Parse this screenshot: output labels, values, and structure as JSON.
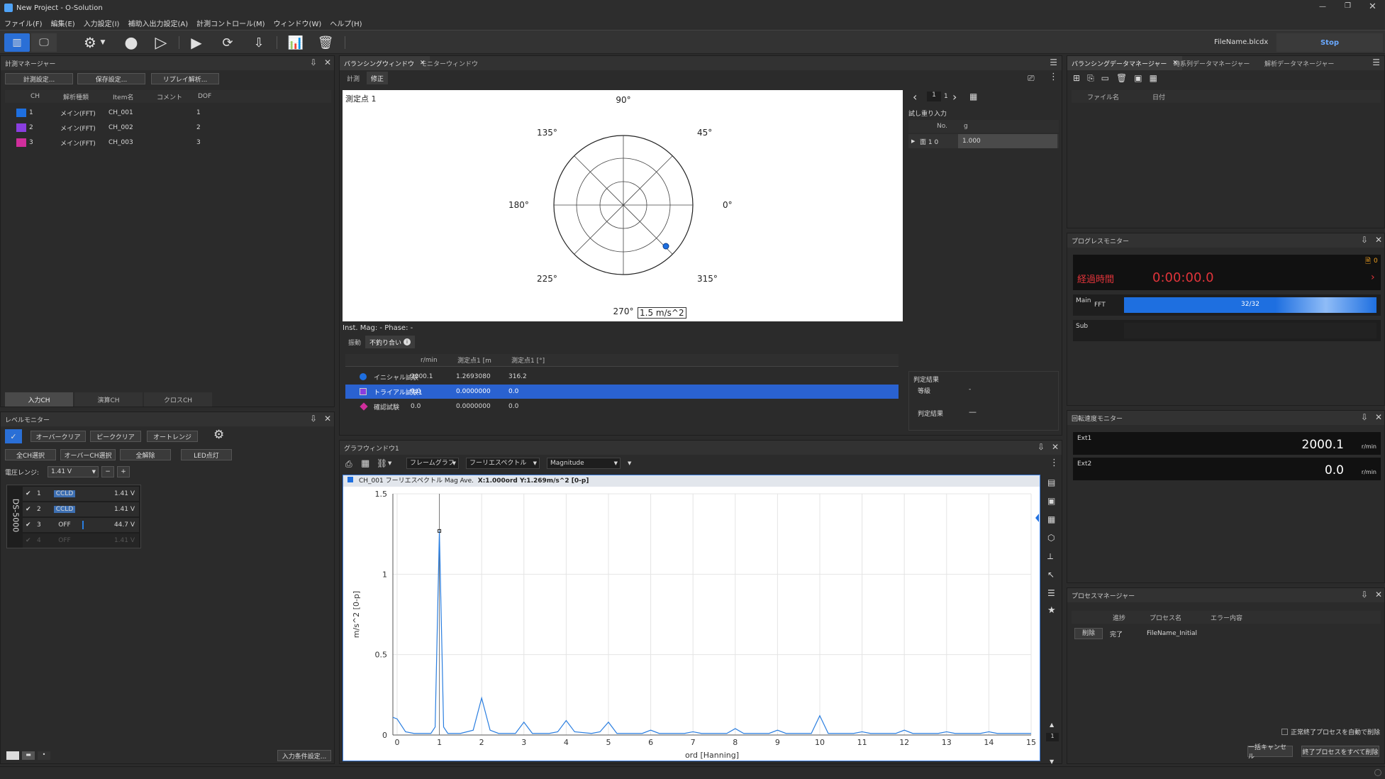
{
  "app": {
    "title": "New Project - O-Solution"
  },
  "menu": [
    "ファイル(F)",
    "編集(E)",
    "入力設定(I)",
    "補助入出力設定(A)",
    "計測コントロール(M)",
    "ウィンドウ(W)",
    "ヘルプ(H)"
  ],
  "toolbar": {
    "filename": "FileName.blcdx",
    "stop_label": "Stop"
  },
  "measure_manager": {
    "title": "計測マネージャー",
    "buttons": [
      "計測設定...",
      "保存設定...",
      "リプレイ解析..."
    ],
    "columns": [
      "CH",
      "解析種類",
      "Item名",
      "コメント",
      "DOF"
    ],
    "rows": [
      {
        "ch": "1",
        "type": "メイン(FFT)",
        "item": "CH_001",
        "comment": "",
        "dof": "1",
        "color": "#1e6fe0"
      },
      {
        "ch": "2",
        "type": "メイン(FFT)",
        "item": "CH_002",
        "comment": "",
        "dof": "2",
        "color": "#8a3ee0"
      },
      {
        "ch": "3",
        "type": "メイン(FFT)",
        "item": "CH_003",
        "comment": "",
        "dof": "3",
        "color": "#d02e9c"
      }
    ],
    "tabs": [
      "入力CH",
      "演算CH",
      "クロスCH"
    ]
  },
  "level_monitor": {
    "title": "レベルモニター",
    "buttons1": [
      "オーバークリア",
      "ピーククリア",
      "オートレンジ"
    ],
    "buttons2": [
      "全CH選択",
      "オーバーCH選択",
      "全解除",
      "LED点灯"
    ],
    "range_label": "電圧レンジ:",
    "range_value": "1.41 V",
    "device": "DS-5000",
    "channels": [
      {
        "num": "1",
        "mode": "CCLD",
        "value": "1.41 V"
      },
      {
        "num": "2",
        "mode": "CCLD",
        "value": "1.41 V"
      },
      {
        "num": "3",
        "mode": "OFF",
        "value": "44.7 V"
      },
      {
        "num": "4",
        "mode": "OFF",
        "value": "1.41 V"
      }
    ],
    "input_settings": "入力条件設定..."
  },
  "balancing": {
    "tabs": [
      "バランシングウィンドウ",
      "モニターウィンドウ"
    ],
    "subtabs": [
      "計測",
      "修正"
    ],
    "point_label": "測定点 1",
    "angles": {
      "a90": "90°",
      "a45": "45°",
      "a0": "0°",
      "a315": "315°",
      "a270": "270°",
      "a225": "225°",
      "a180": "180°",
      "a135": "135°"
    },
    "scale_label": "1.5 m/s^2",
    "inst_label": "Inst.  Mag: -   Phase: -",
    "result_tabs": [
      "振動",
      "不釣り合い"
    ],
    "table_cols": [
      "r/min",
      "測定点1 [m",
      "測定点1 [°]"
    ],
    "table_rows": [
      {
        "name": "イニシャル試験",
        "rpm": "2000.1",
        "mag": "1.2693080",
        "phase": "316.2",
        "color": "#1e6fe0"
      },
      {
        "name": "トライアル試験1",
        "rpm": "0.0",
        "mag": "0.0000000",
        "phase": "0.0",
        "color": "#8a3ee0"
      },
      {
        "name": "確認試験",
        "rpm": "0.0",
        "mag": "0.0000000",
        "phase": "0.0",
        "color": "#d02e9c"
      }
    ],
    "page_current": "1",
    "page_total": "1",
    "trial_title": "試し重り入力",
    "trial_cols": [
      "No.",
      "g"
    ],
    "trial_row": {
      "no": "面 1 0",
      "g": "1.000"
    },
    "judge_title": "判定結果",
    "grade_label": "等級",
    "grade_value": "-",
    "judge_label": "判定結果",
    "judge_value": "—"
  },
  "graph": {
    "title": "グラフウィンドウ1",
    "dropdowns": [
      "フレームグラフ",
      "フーリエスペクトル",
      "Magnitude"
    ],
    "legend": "CH_001   フーリエスペクトル  Mag  Ave.",
    "cursor": "X:1.000ord   Y:1.269m/s^2 [0-p]",
    "page_indicator": "1"
  },
  "chart_data": {
    "type": "line",
    "xlabel": "ord [Hanning]",
    "ylabel": "m/s^2 [0-p]",
    "xlim": [
      -0.1,
      15
    ],
    "ylim": [
      0,
      1.5
    ],
    "xticks": [
      "0",
      "1",
      "2",
      "3",
      "4",
      "5",
      "6",
      "7",
      "8",
      "9",
      "10",
      "11",
      "12",
      "13",
      "14",
      "15"
    ],
    "yticks": [
      "0",
      "0.5",
      "1",
      "1.5"
    ],
    "x": [
      -0.1,
      0,
      0.2,
      0.4,
      0.8,
      0.9,
      1,
      1.1,
      1.2,
      1.5,
      1.8,
      2,
      2.2,
      2.4,
      2.8,
      3,
      3.2,
      3.6,
      3.8,
      4,
      4.2,
      4.6,
      4.8,
      5,
      5.2,
      5.6,
      5.8,
      6,
      6.2,
      6.8,
      7,
      7.2,
      7.8,
      8,
      8.2,
      8.8,
      9,
      9.2,
      9.8,
      10,
      10.2,
      10.8,
      11,
      11.2,
      11.8,
      12,
      12.2,
      12.8,
      13,
      13.2,
      13.8,
      14,
      14.2,
      14.8,
      15
    ],
    "y": [
      0.11,
      0.1,
      0.02,
      0.01,
      0.01,
      0.05,
      1.269,
      0.05,
      0.01,
      0.01,
      0.03,
      0.23,
      0.03,
      0.01,
      0.01,
      0.08,
      0.01,
      0.01,
      0.02,
      0.09,
      0.02,
      0.01,
      0.02,
      0.08,
      0.01,
      0.01,
      0.01,
      0.03,
      0.01,
      0.01,
      0.02,
      0.01,
      0.01,
      0.04,
      0.01,
      0.01,
      0.03,
      0.01,
      0.01,
      0.12,
      0.01,
      0.01,
      0.02,
      0.01,
      0.01,
      0.03,
      0.01,
      0.01,
      0.02,
      0.01,
      0.01,
      0.02,
      0.01,
      0.01,
      0.01
    ],
    "color": "#2a7ee0",
    "cursor_x": 1
  },
  "data_manager": {
    "tabs": [
      "バランシングデータマネージャー",
      "時系列データマネージャー",
      "解析データマネージャー"
    ],
    "columns": [
      "ファイル名",
      "日付"
    ]
  },
  "progress_monitor": {
    "title": "プログレスモニター",
    "badge": "0",
    "elapsed_label": "経過時間",
    "elapsed_value": "0:00:00.0",
    "main_label": "Main",
    "main_type": "FFT",
    "main_progress": "32/32",
    "main_fraction": 1.0,
    "sub_label": "Sub"
  },
  "speed_monitor": {
    "title": "回転速度モニター",
    "items": [
      {
        "label": "Ext1",
        "value": "2000.1",
        "unit": "r/min"
      },
      {
        "label": "Ext2",
        "value": "0.0",
        "unit": "r/min"
      }
    ]
  },
  "process_manager": {
    "title": "プロセスマネージャー",
    "columns": [
      "進捗",
      "プロセス名",
      "エラー内容"
    ],
    "row": {
      "action": "削除",
      "status": "完了",
      "name": "FileName_Initial"
    },
    "auto_delete": "正常終了プロセスを自動で削除",
    "cancel_all": "一括キャンセル",
    "delete_all": "終了プロセスをすべて削除"
  }
}
